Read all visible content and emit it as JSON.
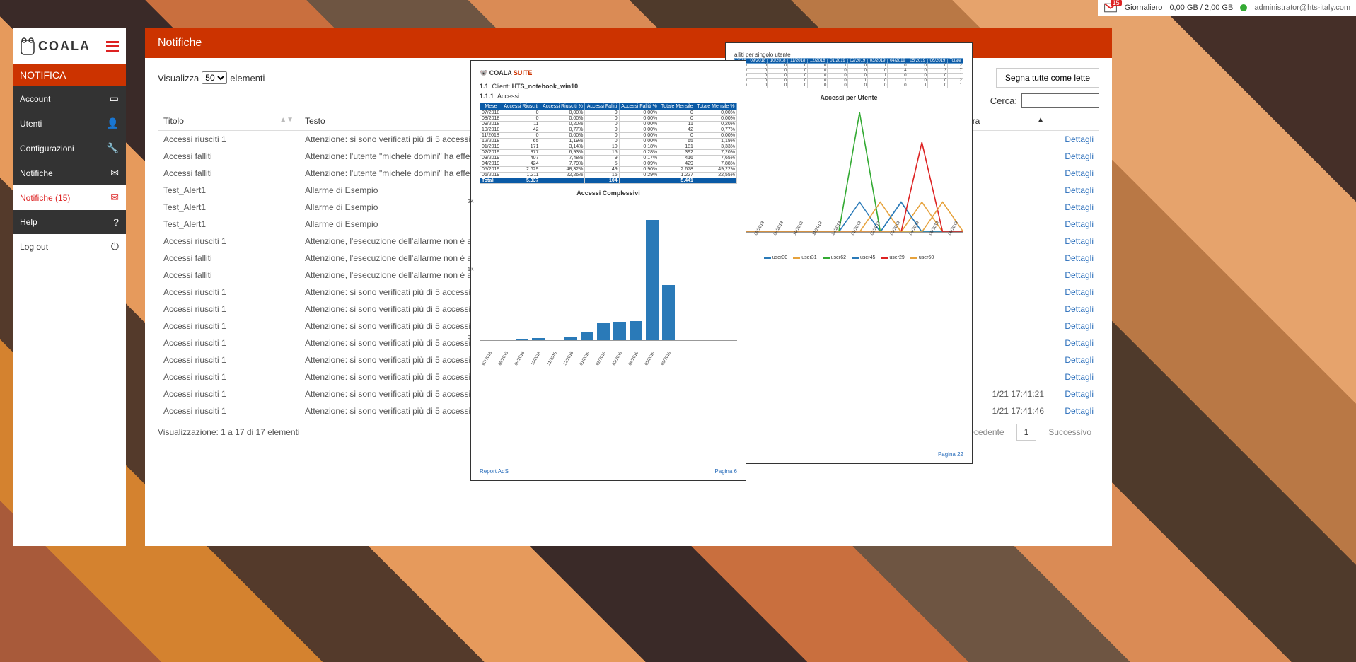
{
  "topbar": {
    "notif_count": "15",
    "plan_label": "Giornaliero",
    "storage": "0,00 GB / 2,00 GB",
    "user": "administrator@hts-italy.com"
  },
  "logo": "COALA",
  "section": "NOTIFICA",
  "menu": [
    {
      "label": "Account",
      "icon": "book-icon"
    },
    {
      "label": "Utenti",
      "icon": "user-icon"
    },
    {
      "label": "Configurazioni",
      "icon": "wrench-icon"
    },
    {
      "label": "Notifiche",
      "icon": "mail-icon"
    },
    {
      "label": "Notifiche (15)",
      "icon": "mail-icon",
      "active": true
    },
    {
      "label": "Help",
      "icon": "help-icon"
    },
    {
      "label": "Log out",
      "icon": "power-icon"
    }
  ],
  "page_title": "Notifiche",
  "toolbar": {
    "show_prefix": "Visualizza",
    "show_suffix": "elementi",
    "page_size": "50",
    "mark_all": "Segna tutte come lette",
    "search_label": "Cerca:"
  },
  "columns": {
    "title": "Titolo",
    "text": "Testo",
    "date": "a lettura",
    "detail": ""
  },
  "rows": [
    {
      "t": "Accessi riusciti 1",
      "x": "Attenzione: si sono verificati più di 5 accessi riusciti negl",
      "d": ""
    },
    {
      "t": "Accessi falliti",
      "x": "Attenzione: l'utente \"michele domini\" ha effettuato più di",
      "d": ""
    },
    {
      "t": "Accessi falliti",
      "x": "Attenzione: l'utente \"michele domini\" ha effettuato più di",
      "d": ""
    },
    {
      "t": "Test_Alert1",
      "x": "Allarme di Esempio",
      "d": ""
    },
    {
      "t": "Test_Alert1",
      "x": "Allarme di Esempio",
      "d": ""
    },
    {
      "t": "Test_Alert1",
      "x": "Allarme di Esempio",
      "d": ""
    },
    {
      "t": "Accessi riusciti 1",
      "x": "Attenzione, l'esecuzione dell'allarme non è andata a buo",
      "d": ""
    },
    {
      "t": "Accessi falliti",
      "x": "Attenzione, l'esecuzione dell'allarme non è andata a buo",
      "d": ""
    },
    {
      "t": "Accessi falliti",
      "x": "Attenzione, l'esecuzione dell'allarme non è andata a buo",
      "d": ""
    },
    {
      "t": "Accessi riusciti 1",
      "x": "Attenzione: si sono verificati più di 5 accessi riusciti negl",
      "d": ""
    },
    {
      "t": "Accessi riusciti 1",
      "x": "Attenzione: si sono verificati più di 5 accessi riusciti negl",
      "d": ""
    },
    {
      "t": "Accessi riusciti 1",
      "x": "Attenzione: si sono verificati più di 5 accessi riusciti negl",
      "d": ""
    },
    {
      "t": "Accessi riusciti 1",
      "x": "Attenzione: si sono verificati più di 5 accessi riusciti negl",
      "d": ""
    },
    {
      "t": "Accessi riusciti 1",
      "x": "Attenzione: si sono verificati più di 5 accessi riusciti negl",
      "d": ""
    },
    {
      "t": "Accessi riusciti 1",
      "x": "Attenzione: si sono verificati più di 5 accessi riusciti negl",
      "d": ""
    },
    {
      "t": "Accessi riusciti 1",
      "x": "Attenzione: si sono verificati più di 5 accessi riusciti negl",
      "d": "1/21 17:41:21"
    },
    {
      "t": "Accessi riusciti 1",
      "x": "Attenzione: si sono verificati più di 5 accessi riusciti negl",
      "d": "1/21 17:41:46"
    }
  ],
  "detail_label": "Dettagli",
  "footer": {
    "info": "Visualizzazione: 1 a 17 di 17 elementi",
    "prev": "Precedente",
    "cur": "1",
    "next": "Successivo"
  },
  "report1": {
    "brand": "COALA",
    "suite": "SUITE",
    "client_label": "Client:",
    "client": "HTS_notebook_win10",
    "sec1": "1.1",
    "sec2": "1.1.1",
    "sec2_label": "Accessi",
    "tbl_head": [
      "Mese",
      "Accessi Riusciti",
      "Accessi Riusciti %",
      "Accessi Falliti",
      "Accessi Falliti %",
      "Totale Mensile",
      "Totale Mensile %"
    ],
    "tbl_rows": [
      [
        "07/2018",
        "0",
        "0,00%",
        "0",
        "0,00%",
        "0",
        "0,00%"
      ],
      [
        "08/2018",
        "0",
        "0,00%",
        "0",
        "0,00%",
        "0",
        "0,00%"
      ],
      [
        "09/2018",
        "11",
        "0,20%",
        "0",
        "0,00%",
        "11",
        "0,20%"
      ],
      [
        "10/2018",
        "42",
        "0,77%",
        "0",
        "0,00%",
        "42",
        "0,77%"
      ],
      [
        "11/2018",
        "0",
        "0,00%",
        "0",
        "0,00%",
        "0",
        "0,00%"
      ],
      [
        "12/2018",
        "65",
        "1,19%",
        "0",
        "0,00%",
        "65",
        "1,19%"
      ],
      [
        "01/2019",
        "171",
        "3,14%",
        "10",
        "0,18%",
        "181",
        "3,33%"
      ],
      [
        "02/2019",
        "377",
        "6,93%",
        "15",
        "0,28%",
        "392",
        "7,20%"
      ],
      [
        "03/2019",
        "407",
        "7,48%",
        "9",
        "0,17%",
        "416",
        "7,65%"
      ],
      [
        "04/2019",
        "424",
        "7,79%",
        "5",
        "0,09%",
        "429",
        "7,88%"
      ],
      [
        "05/2019",
        "2.629",
        "48,32%",
        "49",
        "0,90%",
        "2.678",
        "49,22%"
      ],
      [
        "06/2019",
        "1.211",
        "22,26%",
        "16",
        "0,29%",
        "1.227",
        "22,55%"
      ]
    ],
    "tbl_total": [
      "Totali",
      "5.337",
      "",
      "104",
      "",
      "5.441",
      ""
    ],
    "chart_title": "Accessi Complessivi",
    "footer_left": "Report AdS",
    "footer_right": "Pagina 6"
  },
  "report2": {
    "section_title": "alliti per singolo utente",
    "mini_head": [
      "2018",
      "09/2018",
      "10/2018",
      "11/2018",
      "12/2018",
      "01/2019",
      "02/2019",
      "03/2019",
      "04/2019",
      "05/2019",
      "06/2019",
      "Totale"
    ],
    "mini_rows": [
      [
        "0",
        "0",
        "0",
        "0",
        "0",
        "1",
        "0",
        "1",
        "0",
        "0",
        "0",
        "2"
      ],
      [
        "0",
        "0",
        "0",
        "0",
        "0",
        "0",
        "0",
        "0",
        "4",
        "0",
        "3",
        "7"
      ],
      [
        "0",
        "0",
        "0",
        "0",
        "0",
        "0",
        "0",
        "1",
        "0",
        "0",
        "0",
        "1"
      ],
      [
        "0",
        "0",
        "0",
        "0",
        "0",
        "0",
        "1",
        "0",
        "1",
        "0",
        "0",
        "2"
      ],
      [
        "0",
        "0",
        "0",
        "0",
        "0",
        "0",
        "0",
        "0",
        "0",
        "1",
        "0",
        "1"
      ]
    ],
    "chart_title": "Accessi per Utente",
    "legend": [
      {
        "name": "user30",
        "color": "#2a7ab8"
      },
      {
        "name": "user31",
        "color": "#e6a23c"
      },
      {
        "name": "user62",
        "color": "#3a3"
      },
      {
        "name": "user45",
        "color": "#2a7ab8"
      },
      {
        "name": "user29",
        "color": "#d22"
      },
      {
        "name": "user60",
        "color": "#e6a23c"
      }
    ],
    "x_labels": [
      "07/2018",
      "08/2018",
      "09/2018",
      "10/2018",
      "11/2018",
      "12/2018",
      "01/2019",
      "02/2019",
      "03/2019",
      "04/2019",
      "05/2019",
      "06/2019"
    ],
    "footer_right": "Pagina 22"
  },
  "chart_data": [
    {
      "type": "bar",
      "title": "Accessi Complessivi",
      "categories": [
        "07/2018",
        "08/2018",
        "09/2018",
        "10/2018",
        "11/2018",
        "12/2018",
        "01/2019",
        "02/2019",
        "03/2019",
        "04/2019",
        "05/2019",
        "06/2019"
      ],
      "values": [
        0,
        0,
        11,
        42,
        0,
        65,
        181,
        392,
        416,
        429,
        2678,
        1227
      ],
      "ylabel": "",
      "xlabel": "",
      "ylim": [
        0,
        3000
      ],
      "y_ticks": [
        "0",
        "1K",
        "2K"
      ]
    },
    {
      "type": "line",
      "title": "Accessi per Utente",
      "x": [
        "07/2018",
        "08/2018",
        "09/2018",
        "10/2018",
        "11/2018",
        "12/2018",
        "01/2019",
        "02/2019",
        "03/2019",
        "04/2019",
        "05/2019",
        "06/2019"
      ],
      "series": [
        {
          "name": "user30",
          "color": "#2a7ab8",
          "values": [
            0,
            0,
            0,
            0,
            0,
            0,
            1,
            0,
            1,
            0,
            0,
            0
          ]
        },
        {
          "name": "user31",
          "color": "#e6a23c",
          "values": [
            0,
            0,
            0,
            0,
            0,
            0,
            0,
            1,
            0,
            1,
            0,
            0
          ]
        },
        {
          "name": "user62",
          "color": "#3a3",
          "values": [
            0,
            0,
            0,
            0,
            0,
            0,
            4,
            0,
            0,
            0,
            0,
            0
          ]
        },
        {
          "name": "user45",
          "color": "#2a7ab8",
          "values": [
            0,
            0,
            0,
            0,
            0,
            0,
            0,
            0,
            1,
            0,
            0,
            0
          ]
        },
        {
          "name": "user29",
          "color": "#d22",
          "values": [
            0,
            0,
            0,
            0,
            0,
            0,
            0,
            0,
            0,
            3,
            0,
            0
          ]
        },
        {
          "name": "user60",
          "color": "#e6a23c",
          "values": [
            0,
            0,
            0,
            0,
            0,
            0,
            0,
            0,
            0,
            0,
            1,
            0
          ]
        }
      ],
      "ylim": [
        0,
        4
      ]
    }
  ]
}
